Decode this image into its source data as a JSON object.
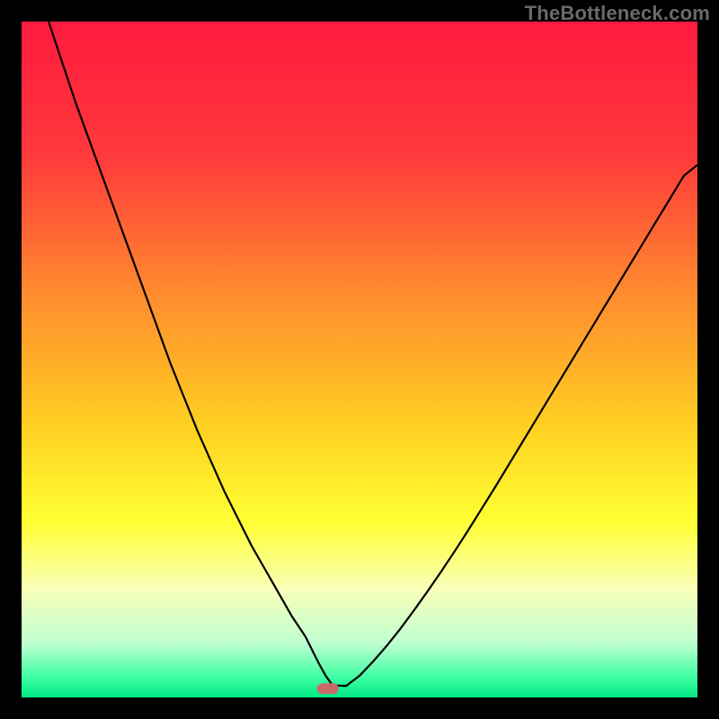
{
  "watermark": "TheBottleneck.com",
  "chart_data": {
    "type": "line",
    "title": "",
    "xlabel": "",
    "ylabel": "",
    "xlim": [
      0,
      100
    ],
    "ylim": [
      0,
      100
    ],
    "background_gradient": {
      "stops": [
        {
          "offset": 0.0,
          "color": "#ff1a3f"
        },
        {
          "offset": 0.2,
          "color": "#ff3a3b"
        },
        {
          "offset": 0.4,
          "color": "#ff8a2e"
        },
        {
          "offset": 0.6,
          "color": "#ffd022"
        },
        {
          "offset": 0.74,
          "color": "#ffff33"
        },
        {
          "offset": 0.84,
          "color": "#f8ffb8"
        },
        {
          "offset": 0.92,
          "color": "#bfffd0"
        },
        {
          "offset": 0.97,
          "color": "#3fffa3"
        },
        {
          "offset": 1.0,
          "color": "#00e985"
        }
      ]
    },
    "series": [
      {
        "name": "bottleneck-curve",
        "color": "#000000",
        "width": 2.2,
        "x": [
          4,
          6,
          8,
          10,
          12,
          14,
          16,
          18,
          20,
          22,
          24,
          26,
          28,
          30,
          32,
          34,
          36,
          38,
          40,
          41,
          42,
          43,
          44,
          45,
          46,
          48,
          50,
          52,
          54,
          56,
          58,
          60,
          62,
          64,
          66,
          68,
          70,
          72,
          74,
          76,
          78,
          80,
          82,
          84,
          86,
          88,
          90,
          92,
          94,
          96,
          98,
          100
        ],
        "y": [
          100,
          94,
          88,
          82.5,
          77,
          71.5,
          66,
          60.5,
          55,
          49.5,
          44.5,
          39.5,
          35,
          30.5,
          26.5,
          22.5,
          19,
          15.5,
          12,
          10.5,
          9,
          7,
          5,
          3.2,
          1.8,
          1.7,
          3.2,
          5.3,
          7.6,
          10.1,
          12.8,
          15.6,
          18.5,
          21.5,
          24.6,
          27.8,
          31.0,
          34.3,
          37.6,
          40.9,
          44.2,
          47.5,
          50.8,
          54.1,
          57.4,
          60.7,
          64.0,
          67.3,
          70.6,
          73.9,
          77.2,
          78.8
        ]
      }
    ],
    "marker": {
      "name": "optimal-marker",
      "x": 45.3,
      "y": 1.3,
      "width": 3.2,
      "height": 1.6,
      "color": "#c96a6a"
    }
  }
}
